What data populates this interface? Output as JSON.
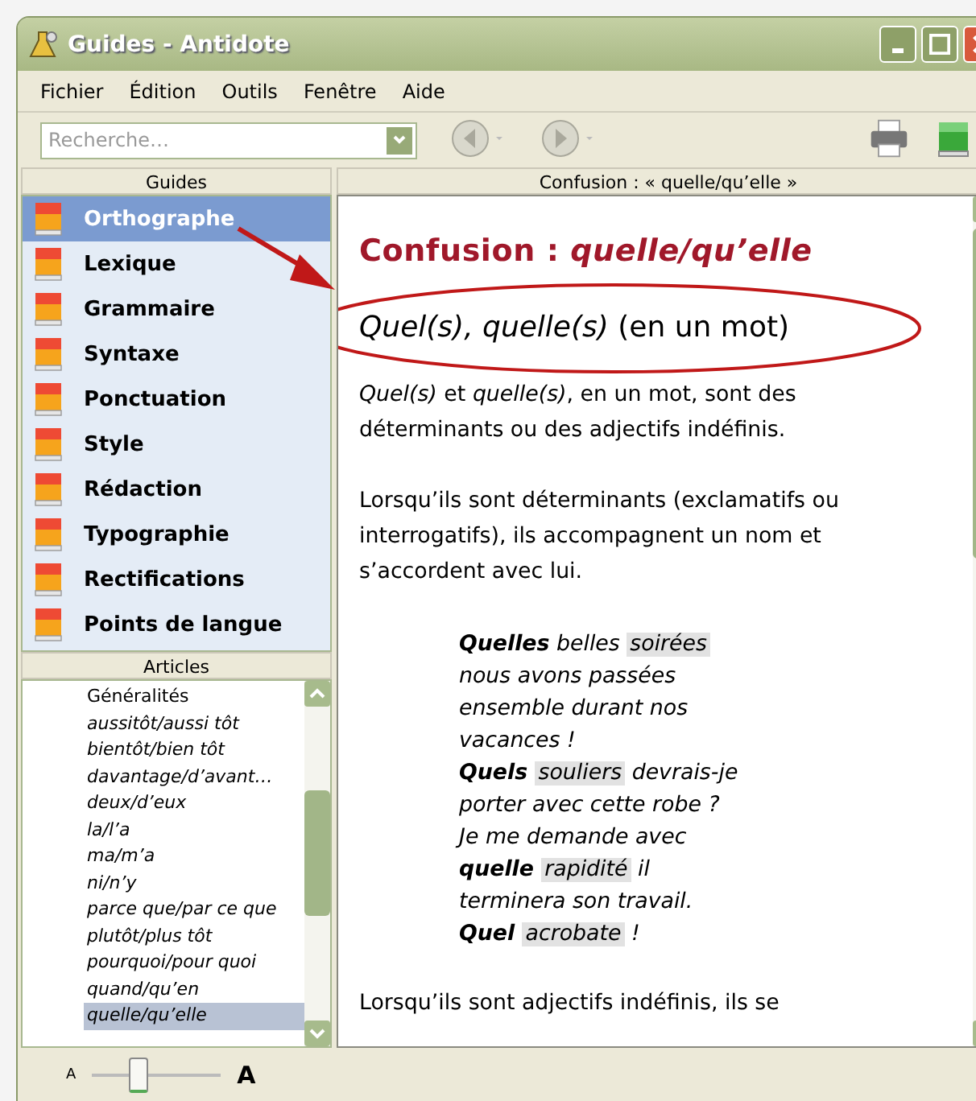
{
  "window": {
    "title": "Guides - Antidote"
  },
  "menu": [
    "Fichier",
    "Édition",
    "Outils",
    "Fenêtre",
    "Aide"
  ],
  "toolbar": {
    "search": {
      "placeholder": "Recherche…"
    }
  },
  "guides": {
    "header": "Guides",
    "items": [
      {
        "label": "Orthographe",
        "selected": true
      },
      {
        "label": "Lexique",
        "selected": false
      },
      {
        "label": "Grammaire",
        "selected": false
      },
      {
        "label": "Syntaxe",
        "selected": false
      },
      {
        "label": "Ponctuation",
        "selected": false
      },
      {
        "label": "Style",
        "selected": false
      },
      {
        "label": "Rédaction",
        "selected": false
      },
      {
        "label": "Typographie",
        "selected": false
      },
      {
        "label": "Rectifications",
        "selected": false
      },
      {
        "label": "Points de langue",
        "selected": false
      }
    ]
  },
  "articles": {
    "header": "Articles",
    "items": [
      {
        "label": "Généralités",
        "kind": "heading",
        "selected": false
      },
      {
        "label": "aussitôt/aussi tôt",
        "kind": "entry",
        "selected": false
      },
      {
        "label": "bientôt/bien tôt",
        "kind": "entry",
        "selected": false
      },
      {
        "label": "davantage/d’avant…",
        "kind": "entry",
        "selected": false
      },
      {
        "label": "deux/d’eux",
        "kind": "entry",
        "selected": false
      },
      {
        "label": "la/l’a",
        "kind": "entry",
        "selected": false
      },
      {
        "label": "ma/m’a",
        "kind": "entry",
        "selected": false
      },
      {
        "label": "ni/n’y",
        "kind": "entry",
        "selected": false
      },
      {
        "label": "parce que/par ce que",
        "kind": "entry",
        "selected": false
      },
      {
        "label": "plutôt/plus tôt",
        "kind": "entry",
        "selected": false
      },
      {
        "label": "pourquoi/pour quoi",
        "kind": "entry",
        "selected": false
      },
      {
        "label": "quand/qu’en",
        "kind": "entry",
        "selected": false
      },
      {
        "label": "quelle/qu’elle",
        "kind": "entry",
        "selected": true
      }
    ]
  },
  "zoom_slider": {
    "min_label": "A",
    "max_label": "A",
    "level": 0.35
  },
  "article": {
    "header": "Confusion : « quelle/qu’elle »",
    "title": "Confusion : *quelle/qu’elle*",
    "subtitle": "*Quel(s), quelle(s)* (en un mot)",
    "body": [
      {
        "kind": "paragraph",
        "text": "*Quel(s)* et *quelle(s)*, en un mot, sont des déterminants ou des adjectifs indéfinis."
      },
      {
        "kind": "paragraph",
        "text": "Lorsqu’ils sont déterminants (exclamatifs ou interrogatifs), ils accompagnent un nom et s’accordent avec lui."
      },
      {
        "kind": "example",
        "lines": [
          [
            {
              "text": "Quelles",
              "kind": "bold"
            },
            {
              "text": " belles ",
              "kind": "plain"
            },
            {
              "text": "soirées",
              "kind": "highlight"
            }
          ],
          [
            {
              "text": "nous avons passées",
              "kind": "plain"
            }
          ],
          [
            {
              "text": "ensemble durant nos",
              "kind": "plain"
            }
          ],
          [
            {
              "text": "vacances !",
              "kind": "plain"
            }
          ],
          [
            {
              "text": "Quels ",
              "kind": "bold"
            },
            {
              "text": "souliers",
              "kind": "highlight"
            },
            {
              "text": " devrais-je",
              "kind": "plain"
            }
          ],
          [
            {
              "text": "porter avec cette robe ?",
              "kind": "plain"
            }
          ],
          [
            {
              "text": "Je me demande avec",
              "kind": "plain"
            }
          ],
          [
            {
              "text": "quelle ",
              "kind": "bold"
            },
            {
              "text": "rapidité",
              "kind": "highlight"
            },
            {
              "text": " il",
              "kind": "plain"
            }
          ],
          [
            {
              "text": "terminera son travail.",
              "kind": "plain"
            }
          ],
          [
            {
              "text": "Quel ",
              "kind": "bold"
            },
            {
              "text": "acrobate",
              "kind": "highlight"
            },
            {
              "text": " !",
              "kind": "plain"
            }
          ]
        ]
      },
      {
        "kind": "paragraph",
        "text": "Lorsqu’ils sont adjectifs indéfinis, ils se"
      }
    ]
  }
}
